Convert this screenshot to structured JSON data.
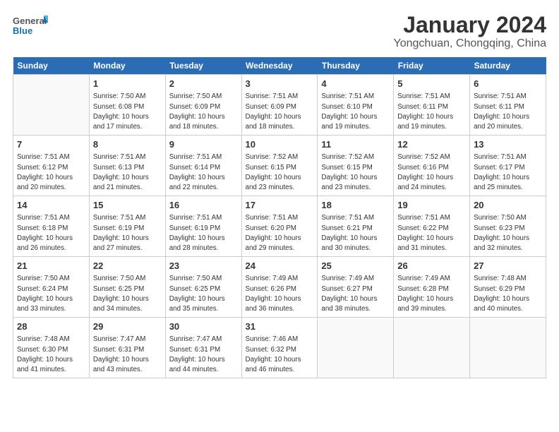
{
  "logo": {
    "line1": "General",
    "line2": "Blue"
  },
  "title": "January 2024",
  "subtitle": "Yongchuan, Chongqing, China",
  "headers": [
    "Sunday",
    "Monday",
    "Tuesday",
    "Wednesday",
    "Thursday",
    "Friday",
    "Saturday"
  ],
  "weeks": [
    [
      {
        "day": "",
        "info": ""
      },
      {
        "day": "1",
        "info": "Sunrise: 7:50 AM\nSunset: 6:08 PM\nDaylight: 10 hours\nand 17 minutes."
      },
      {
        "day": "2",
        "info": "Sunrise: 7:50 AM\nSunset: 6:09 PM\nDaylight: 10 hours\nand 18 minutes."
      },
      {
        "day": "3",
        "info": "Sunrise: 7:51 AM\nSunset: 6:09 PM\nDaylight: 10 hours\nand 18 minutes."
      },
      {
        "day": "4",
        "info": "Sunrise: 7:51 AM\nSunset: 6:10 PM\nDaylight: 10 hours\nand 19 minutes."
      },
      {
        "day": "5",
        "info": "Sunrise: 7:51 AM\nSunset: 6:11 PM\nDaylight: 10 hours\nand 19 minutes."
      },
      {
        "day": "6",
        "info": "Sunrise: 7:51 AM\nSunset: 6:11 PM\nDaylight: 10 hours\nand 20 minutes."
      }
    ],
    [
      {
        "day": "7",
        "info": "Sunrise: 7:51 AM\nSunset: 6:12 PM\nDaylight: 10 hours\nand 20 minutes."
      },
      {
        "day": "8",
        "info": "Sunrise: 7:51 AM\nSunset: 6:13 PM\nDaylight: 10 hours\nand 21 minutes."
      },
      {
        "day": "9",
        "info": "Sunrise: 7:51 AM\nSunset: 6:14 PM\nDaylight: 10 hours\nand 22 minutes."
      },
      {
        "day": "10",
        "info": "Sunrise: 7:52 AM\nSunset: 6:15 PM\nDaylight: 10 hours\nand 23 minutes."
      },
      {
        "day": "11",
        "info": "Sunrise: 7:52 AM\nSunset: 6:15 PM\nDaylight: 10 hours\nand 23 minutes."
      },
      {
        "day": "12",
        "info": "Sunrise: 7:52 AM\nSunset: 6:16 PM\nDaylight: 10 hours\nand 24 minutes."
      },
      {
        "day": "13",
        "info": "Sunrise: 7:51 AM\nSunset: 6:17 PM\nDaylight: 10 hours\nand 25 minutes."
      }
    ],
    [
      {
        "day": "14",
        "info": "Sunrise: 7:51 AM\nSunset: 6:18 PM\nDaylight: 10 hours\nand 26 minutes."
      },
      {
        "day": "15",
        "info": "Sunrise: 7:51 AM\nSunset: 6:19 PM\nDaylight: 10 hours\nand 27 minutes."
      },
      {
        "day": "16",
        "info": "Sunrise: 7:51 AM\nSunset: 6:19 PM\nDaylight: 10 hours\nand 28 minutes."
      },
      {
        "day": "17",
        "info": "Sunrise: 7:51 AM\nSunset: 6:20 PM\nDaylight: 10 hours\nand 29 minutes."
      },
      {
        "day": "18",
        "info": "Sunrise: 7:51 AM\nSunset: 6:21 PM\nDaylight: 10 hours\nand 30 minutes."
      },
      {
        "day": "19",
        "info": "Sunrise: 7:51 AM\nSunset: 6:22 PM\nDaylight: 10 hours\nand 31 minutes."
      },
      {
        "day": "20",
        "info": "Sunrise: 7:50 AM\nSunset: 6:23 PM\nDaylight: 10 hours\nand 32 minutes."
      }
    ],
    [
      {
        "day": "21",
        "info": "Sunrise: 7:50 AM\nSunset: 6:24 PM\nDaylight: 10 hours\nand 33 minutes."
      },
      {
        "day": "22",
        "info": "Sunrise: 7:50 AM\nSunset: 6:25 PM\nDaylight: 10 hours\nand 34 minutes."
      },
      {
        "day": "23",
        "info": "Sunrise: 7:50 AM\nSunset: 6:25 PM\nDaylight: 10 hours\nand 35 minutes."
      },
      {
        "day": "24",
        "info": "Sunrise: 7:49 AM\nSunset: 6:26 PM\nDaylight: 10 hours\nand 36 minutes."
      },
      {
        "day": "25",
        "info": "Sunrise: 7:49 AM\nSunset: 6:27 PM\nDaylight: 10 hours\nand 38 minutes."
      },
      {
        "day": "26",
        "info": "Sunrise: 7:49 AM\nSunset: 6:28 PM\nDaylight: 10 hours\nand 39 minutes."
      },
      {
        "day": "27",
        "info": "Sunrise: 7:48 AM\nSunset: 6:29 PM\nDaylight: 10 hours\nand 40 minutes."
      }
    ],
    [
      {
        "day": "28",
        "info": "Sunrise: 7:48 AM\nSunset: 6:30 PM\nDaylight: 10 hours\nand 41 minutes."
      },
      {
        "day": "29",
        "info": "Sunrise: 7:47 AM\nSunset: 6:31 PM\nDaylight: 10 hours\nand 43 minutes."
      },
      {
        "day": "30",
        "info": "Sunrise: 7:47 AM\nSunset: 6:31 PM\nDaylight: 10 hours\nand 44 minutes."
      },
      {
        "day": "31",
        "info": "Sunrise: 7:46 AM\nSunset: 6:32 PM\nDaylight: 10 hours\nand 46 minutes."
      },
      {
        "day": "",
        "info": ""
      },
      {
        "day": "",
        "info": ""
      },
      {
        "day": "",
        "info": ""
      }
    ]
  ]
}
